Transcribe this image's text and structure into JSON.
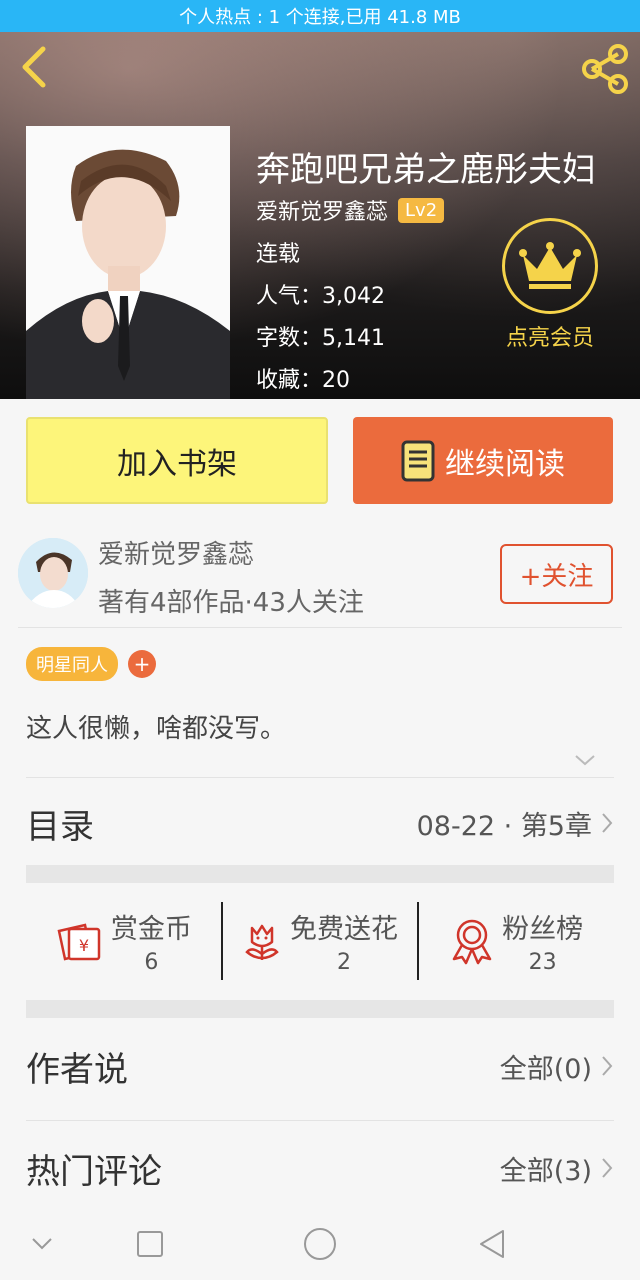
{
  "status_bar": {
    "text": "个人热点 : 1 个连接,已用 41.8 MB"
  },
  "book": {
    "title": "奔跑吧兄弟之鹿彤夫妇",
    "author": "爱新觉罗鑫蕊",
    "level": "Lv2",
    "status": "连载",
    "popularity_label": "人气：",
    "popularity": "3,042",
    "words_label": "字数：",
    "words": "5,141",
    "favorites_label": "收藏：",
    "favorites": "20"
  },
  "vip": {
    "label": "点亮会员"
  },
  "actions": {
    "shelf_label": "加入书架",
    "read_label": "继续阅读"
  },
  "author_card": {
    "name": "爱新觉罗鑫蕊",
    "stats": "著有4部作品·43人关注",
    "follow_label": "+关注"
  },
  "tags": [
    {
      "label": "明星同人"
    }
  ],
  "tag_add": "+",
  "intro": "这人很懒，啥都没写。",
  "catalog": {
    "title": "目录",
    "latest": "08-22 · 第5章"
  },
  "stats": [
    {
      "label": "赏金币",
      "value": "6",
      "icon": "red-envelope-icon"
    },
    {
      "label": "免费送花",
      "value": "2",
      "icon": "flower-icon"
    },
    {
      "label": "粉丝榜",
      "value": "23",
      "icon": "medal-icon"
    }
  ],
  "author_says": {
    "title": "作者说",
    "link": "全部(0)"
  },
  "hot_comments": {
    "title": "热门评论",
    "link": "全部(3)"
  },
  "colors": {
    "accent_orange": "#eb6b3d",
    "shelf_yellow": "#fdf57a",
    "gold": "#f5d34a",
    "status_blue": "#29b6f6"
  }
}
